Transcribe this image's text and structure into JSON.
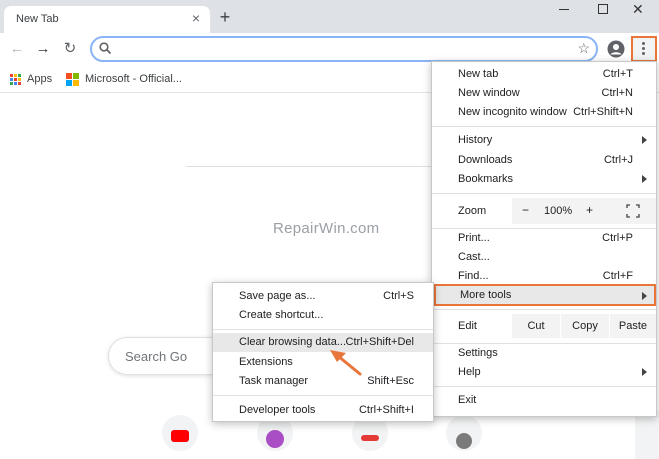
{
  "tab": {
    "title": "New Tab"
  },
  "icons": {
    "close": "×",
    "new_tab": "+",
    "window_close": "✕",
    "back": "←",
    "forward": "→",
    "reload": "↻",
    "star": "☆",
    "zoom_minus": "−",
    "zoom_plus": "+"
  },
  "bookmarks": [
    {
      "label": "Apps"
    },
    {
      "label": "Microsoft - Official..."
    }
  ],
  "page": {
    "watermark": "RepairWin.com",
    "search_placeholder": "Search Go"
  },
  "menu": {
    "new_tab": {
      "label": "New tab",
      "shortcut": "Ctrl+T"
    },
    "new_window": {
      "label": "New window",
      "shortcut": "Ctrl+N"
    },
    "new_incognito": {
      "label": "New incognito window",
      "shortcut": "Ctrl+Shift+N"
    },
    "history": {
      "label": "History"
    },
    "downloads": {
      "label": "Downloads",
      "shortcut": "Ctrl+J"
    },
    "bookmarks": {
      "label": "Bookmarks"
    },
    "zoom": {
      "label": "Zoom",
      "value": "100%"
    },
    "print": {
      "label": "Print...",
      "shortcut": "Ctrl+P"
    },
    "cast": {
      "label": "Cast..."
    },
    "find": {
      "label": "Find...",
      "shortcut": "Ctrl+F"
    },
    "more_tools": {
      "label": "More tools"
    },
    "edit": {
      "label": "Edit",
      "cut": "Cut",
      "copy": "Copy",
      "paste": "Paste"
    },
    "settings": {
      "label": "Settings"
    },
    "help": {
      "label": "Help"
    },
    "exit": {
      "label": "Exit"
    }
  },
  "submenu": {
    "save_page": {
      "label": "Save page as...",
      "shortcut": "Ctrl+S"
    },
    "create_shortcut": {
      "label": "Create shortcut..."
    },
    "clear_browsing": {
      "label": "Clear browsing data...",
      "shortcut": "Ctrl+Shift+Del"
    },
    "extensions": {
      "label": "Extensions"
    },
    "task_manager": {
      "label": "Task manager",
      "shortcut": "Shift+Esc"
    },
    "developer_tools": {
      "label": "Developer tools",
      "shortcut": "Ctrl+Shift+I"
    }
  },
  "colors": {
    "highlight_border": "#e8753a",
    "annotation_arrow": "#e8753a"
  }
}
